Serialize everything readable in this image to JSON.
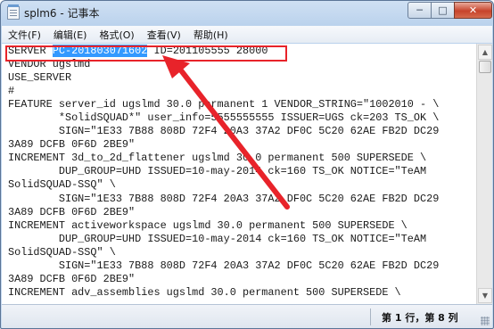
{
  "window": {
    "title": "splm6 - 记事本"
  },
  "titlebar_buttons": {
    "minimize": "─",
    "maximize": "□",
    "close": "✕"
  },
  "menu": [
    {
      "label": "文件(F)"
    },
    {
      "label": "编辑(E)"
    },
    {
      "label": "格式(O)"
    },
    {
      "label": "查看(V)"
    },
    {
      "label": "帮助(H)"
    }
  ],
  "editor": {
    "line1_prefix": "SERVER ",
    "line1_selected": "PC-201803071602",
    "line1_suffix": " ID=201105555 28000",
    "rest": "VENDOR ugslmd\nUSE_SERVER\n#\nFEATURE server_id ugslmd 30.0 permanent 1 VENDOR_STRING=\"1002010 - \\\n        *SolidSQUAD*\" user_info=5555555555 ISSUER=UGS ck=203 TS_OK \\\n        SIGN=\"1E33 7B88 808D 72F4 20A3 37A2 DF0C 5C20 62AE FB2D DC29\n3A89 DCFB 0F6D 2BE9\"\nINCREMENT 3d_to_2d_flattener ugslmd 30.0 permanent 500 SUPERSEDE \\\n        DUP_GROUP=UHD ISSUED=10-may-2014 ck=160 TS_OK NOTICE=\"TeAM\nSolidSQUAD-SSQ\" \\\n        SIGN=\"1E33 7B88 808D 72F4 20A3 37A2 DF0C 5C20 62AE FB2D DC29\n3A89 DCFB 0F6D 2BE9\"\nINCREMENT activeworkspace ugslmd 30.0 permanent 500 SUPERSEDE \\\n        DUP_GROUP=UHD ISSUED=10-may-2014 ck=160 TS_OK NOTICE=\"TeAM\nSolidSQUAD-SSQ\" \\\n        SIGN=\"1E33 7B88 808D 72F4 20A3 37A2 DF0C 5C20 62AE FB2D DC29\n3A89 DCFB 0F6D 2BE9\"\nINCREMENT adv_assemblies ugslmd 30.0 permanent 500 SUPERSEDE \\"
  },
  "statusbar": {
    "position": "第 1 行，第 8 列"
  },
  "colors": {
    "selection": "#3399ff",
    "annotation": "#e8232a"
  },
  "icons": {
    "app": "notepad-icon",
    "annotation": "red-arrow-icon"
  }
}
